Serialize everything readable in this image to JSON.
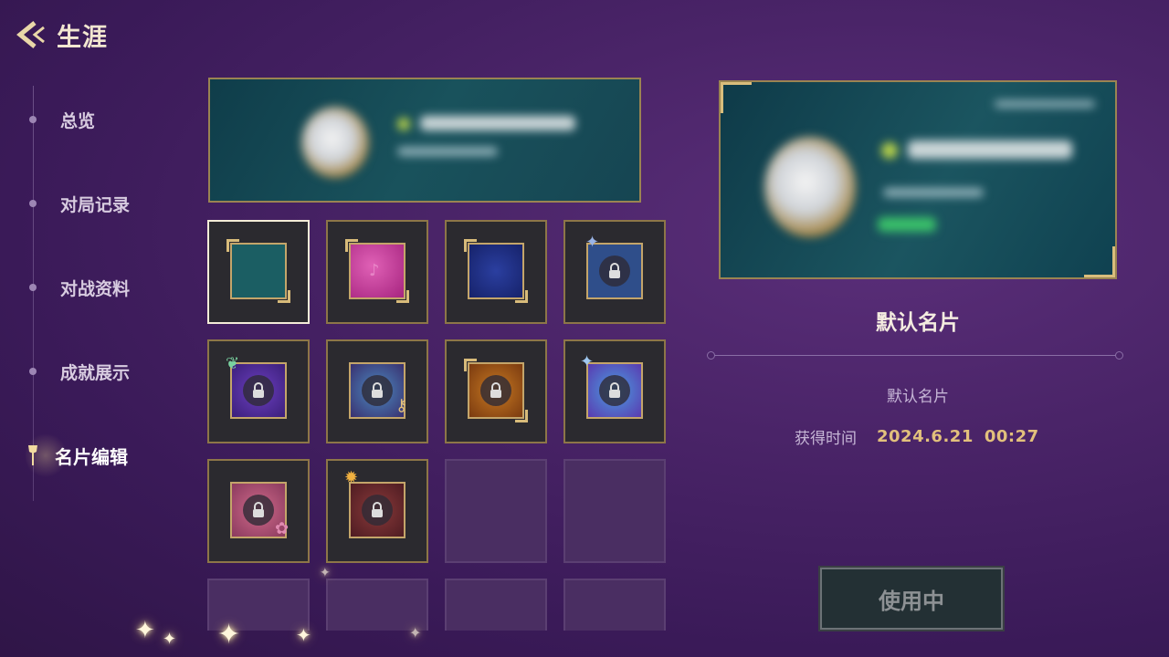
{
  "header": {
    "title": "生涯"
  },
  "sidebar": {
    "items": [
      {
        "label": "总览",
        "active": false
      },
      {
        "label": "对局记录",
        "active": false
      },
      {
        "label": "对战资料",
        "active": false
      },
      {
        "label": "成就展示",
        "active": false
      },
      {
        "label": "名片编辑",
        "active": true
      }
    ]
  },
  "grid": {
    "tiles": [
      {
        "name": "default-teal",
        "color": "#1b5e63",
        "locked": false,
        "selected": true
      },
      {
        "name": "pink-music",
        "color": "#c23a9b",
        "locked": false,
        "selected": false
      },
      {
        "name": "navy-blue",
        "color": "#1d2f86",
        "locked": false,
        "selected": false
      },
      {
        "name": "blue-locked-1",
        "color": "#2f4e8a",
        "locked": true,
        "selected": false
      },
      {
        "name": "purple-locked",
        "color": "#5b2f95",
        "locked": true,
        "selected": false
      },
      {
        "name": "teal-purple-locked",
        "color": "#3a6a9a",
        "locked": true,
        "selected": false
      },
      {
        "name": "orange-locked",
        "color": "#b5641a",
        "locked": true,
        "selected": false
      },
      {
        "name": "blue-purple-locked",
        "color": "#4060b5",
        "locked": true,
        "selected": false
      },
      {
        "name": "pink-locked",
        "color": "#b8506e",
        "locked": true,
        "selected": false
      },
      {
        "name": "red-brown-locked",
        "color": "#8a3a3a",
        "locked": true,
        "selected": false
      }
    ]
  },
  "detail": {
    "card_name": "默认名片",
    "description": "默认名片",
    "acquired_label": "获得时间",
    "acquired_date": "2024.6.21",
    "acquired_time": "00:27",
    "use_button_label": "使用中"
  },
  "colors": {
    "accent_gold": "#e2c07c",
    "frame_gold": "#9a8452",
    "background": "#4a2468"
  }
}
